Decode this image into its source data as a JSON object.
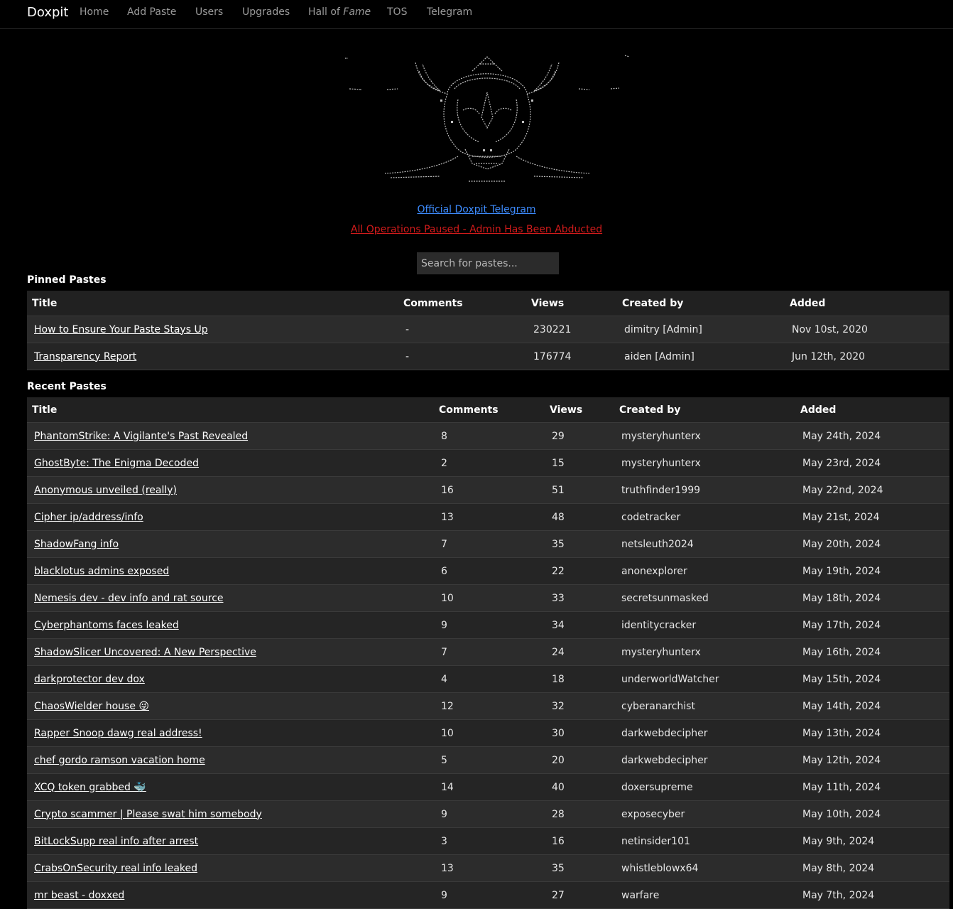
{
  "nav": {
    "brand": "Doxpit",
    "links": [
      {
        "label": "Home"
      },
      {
        "label": "Add Paste"
      },
      {
        "label": "Users"
      },
      {
        "label": "Upgrades"
      },
      {
        "label_pre": "Hall of ",
        "label_em": "Fame"
      },
      {
        "label": "TOS"
      },
      {
        "label": "Telegram"
      }
    ]
  },
  "logo": {
    "icon": "ascii-art-horned-skull-icon",
    "color": "#bfbfbf"
  },
  "announcements": {
    "telegram_link": "Official Doxpit Telegram",
    "alert_link": "All Operations Paused - Admin Has Been Abducted",
    "telegram_color": "#3d8bfd",
    "alert_color": "#d11b1b"
  },
  "search": {
    "placeholder": "Search for pastes..."
  },
  "pinned": {
    "title": "Pinned Pastes",
    "headers": [
      "Title",
      "Comments",
      "Views",
      "Created by",
      "Added"
    ],
    "rows": [
      {
        "title": "How to Ensure Your Paste Stays Up",
        "comments": "-",
        "views": "230221",
        "created_by": "dimitry [Admin]",
        "added": "Nov 10st, 2020"
      },
      {
        "title": "Transparency Report",
        "comments": "-",
        "views": "176774",
        "created_by": "aiden [Admin]",
        "added": "Jun 12th, 2020"
      }
    ]
  },
  "recent": {
    "title": "Recent Pastes",
    "headers": [
      "Title",
      "Comments",
      "Views",
      "Created by",
      "Added"
    ],
    "rows": [
      {
        "title": "PhantomStrike: A Vigilante's Past Revealed",
        "comments": "8",
        "views": "29",
        "created_by": "mysteryhunterx",
        "added": "May 24th, 2024"
      },
      {
        "title": "GhostByte: The Enigma Decoded",
        "comments": "2",
        "views": "15",
        "created_by": "mysteryhunterx",
        "added": "May 23rd, 2024"
      },
      {
        "title": "Anonymous unveiled (really)",
        "comments": "16",
        "views": "51",
        "created_by": "truthfinder1999",
        "added": "May 22nd, 2024"
      },
      {
        "title": "Cipher ip/address/info",
        "comments": "13",
        "views": "48",
        "created_by": "codetracker",
        "added": "May 21st, 2024"
      },
      {
        "title": "ShadowFang info",
        "comments": "7",
        "views": "35",
        "created_by": "netsleuth2024",
        "added": "May 20th, 2024"
      },
      {
        "title": "blacklotus admins exposed",
        "comments": "6",
        "views": "22",
        "created_by": "anonexplorer",
        "added": "May 19th, 2024"
      },
      {
        "title": "Nemesis dev - dev info and rat source",
        "comments": "10",
        "views": "33",
        "created_by": "secretsunmasked",
        "added": "May 18th, 2024"
      },
      {
        "title": "Cyberphantoms faces leaked",
        "comments": "9",
        "views": "34",
        "created_by": "identitycracker",
        "added": "May 17th, 2024"
      },
      {
        "title": "ShadowSlicer Uncovered: A New Perspective",
        "comments": "7",
        "views": "24",
        "created_by": "mysteryhunterx",
        "added": "May 16th, 2024"
      },
      {
        "title": "darkprotector dev dox",
        "comments": "4",
        "views": "18",
        "created_by": "underworldWatcher",
        "added": "May 15th, 2024"
      },
      {
        "title": "ChaosWielder house 😜",
        "comments": "12",
        "views": "32",
        "created_by": "cyberanarchist",
        "added": "May 14th, 2024"
      },
      {
        "title": "Rapper Snoop dawg real address!",
        "comments": "10",
        "views": "30",
        "created_by": "darkwebdecipher",
        "added": "May 13th, 2024"
      },
      {
        "title": "chef gordo ramson vacation home",
        "comments": "5",
        "views": "20",
        "created_by": "darkwebdecipher",
        "added": "May 12th, 2024"
      },
      {
        "title": "XCQ token grabbed 🐳",
        "comments": "14",
        "views": "40",
        "created_by": "doxersupreme",
        "added": "May 11th, 2024"
      },
      {
        "title": "Crypto scammer | Please swat him somebody",
        "comments": "9",
        "views": "28",
        "created_by": "exposecyber",
        "added": "May 10th, 2024"
      },
      {
        "title": "BitLockSupp real info after arrest",
        "comments": "3",
        "views": "16",
        "created_by": "netinsider101",
        "added": "May 9th, 2024"
      },
      {
        "title": "CrabsOnSecurity real info leaked",
        "comments": "13",
        "views": "35",
        "created_by": "whistleblowx64",
        "added": "May 8th, 2024"
      },
      {
        "title": "mr beast - doxxed",
        "comments": "9",
        "views": "27",
        "created_by": "warfare",
        "added": "May 7th, 2024"
      }
    ]
  }
}
